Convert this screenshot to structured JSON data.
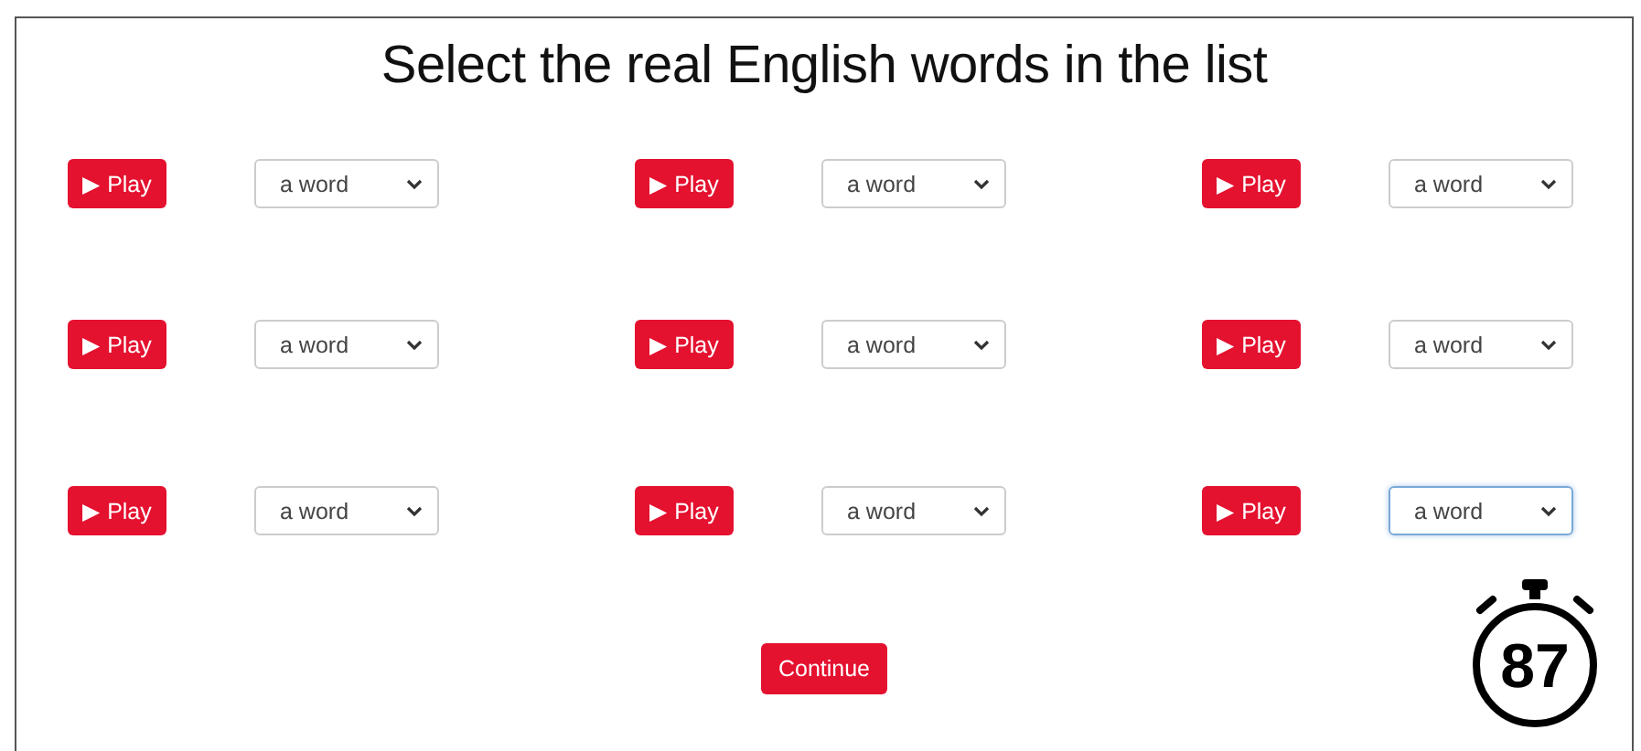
{
  "title": "Select the real English words in the list",
  "items": [
    {
      "play_label": "▶ Play",
      "select_value": "a word",
      "focused": false
    },
    {
      "play_label": "▶ Play",
      "select_value": "a word",
      "focused": false
    },
    {
      "play_label": "▶ Play",
      "select_value": "a word",
      "focused": false
    },
    {
      "play_label": "▶ Play",
      "select_value": "a word",
      "focused": false
    },
    {
      "play_label": "▶ Play",
      "select_value": "a word",
      "focused": false
    },
    {
      "play_label": "▶ Play",
      "select_value": "a word",
      "focused": false
    },
    {
      "play_label": "▶ Play",
      "select_value": "a word",
      "focused": false
    },
    {
      "play_label": "▶ Play",
      "select_value": "a word",
      "focused": false
    },
    {
      "play_label": "▶ Play",
      "select_value": "a word",
      "focused": true
    }
  ],
  "continue_button": "Continue",
  "timer": "87"
}
